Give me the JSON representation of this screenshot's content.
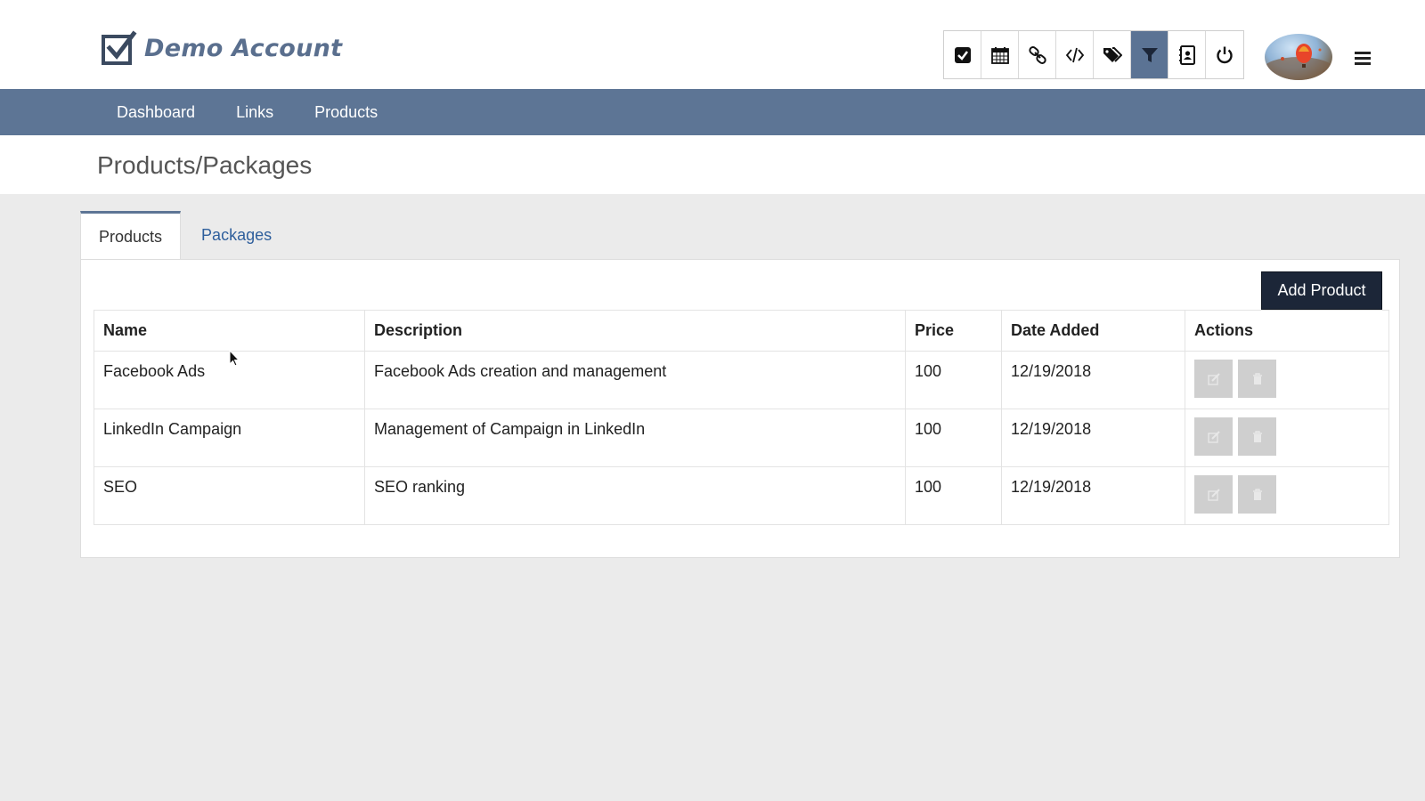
{
  "header": {
    "brand_title": "Demo Account",
    "toolbar": [
      {
        "icon": "check-square-icon",
        "active": false
      },
      {
        "icon": "calendar-icon",
        "active": false
      },
      {
        "icon": "link-icon",
        "active": false
      },
      {
        "icon": "code-icon",
        "active": false
      },
      {
        "icon": "tags-icon",
        "active": false
      },
      {
        "icon": "filter-icon",
        "active": true
      },
      {
        "icon": "contact-book-icon",
        "active": false
      },
      {
        "icon": "power-icon",
        "active": false
      }
    ]
  },
  "nav": {
    "items": [
      "Dashboard",
      "Links",
      "Products"
    ]
  },
  "page": {
    "title": "Products/Packages"
  },
  "tabs": [
    {
      "label": "Products",
      "active": true
    },
    {
      "label": "Packages",
      "active": false
    }
  ],
  "panel": {
    "add_button": "Add Product"
  },
  "table": {
    "headers": [
      "Name",
      "Description",
      "Price",
      "Date Added",
      "Actions"
    ],
    "rows": [
      {
        "name": "Facebook Ads",
        "description": "Facebook Ads creation and management",
        "price": "100",
        "date": "12/19/2018"
      },
      {
        "name": "LinkedIn Campaign",
        "description": "Management of Campaign in LinkedIn",
        "price": "100",
        "date": "12/19/2018"
      },
      {
        "name": "SEO",
        "description": "SEO ranking",
        "price": "100",
        "date": "12/19/2018"
      }
    ]
  },
  "colors": {
    "nav_bg": "#5d7595",
    "brand": "#5a6f8e",
    "add_button_bg": "#1c2638",
    "tab_link": "#2f5f9c"
  }
}
